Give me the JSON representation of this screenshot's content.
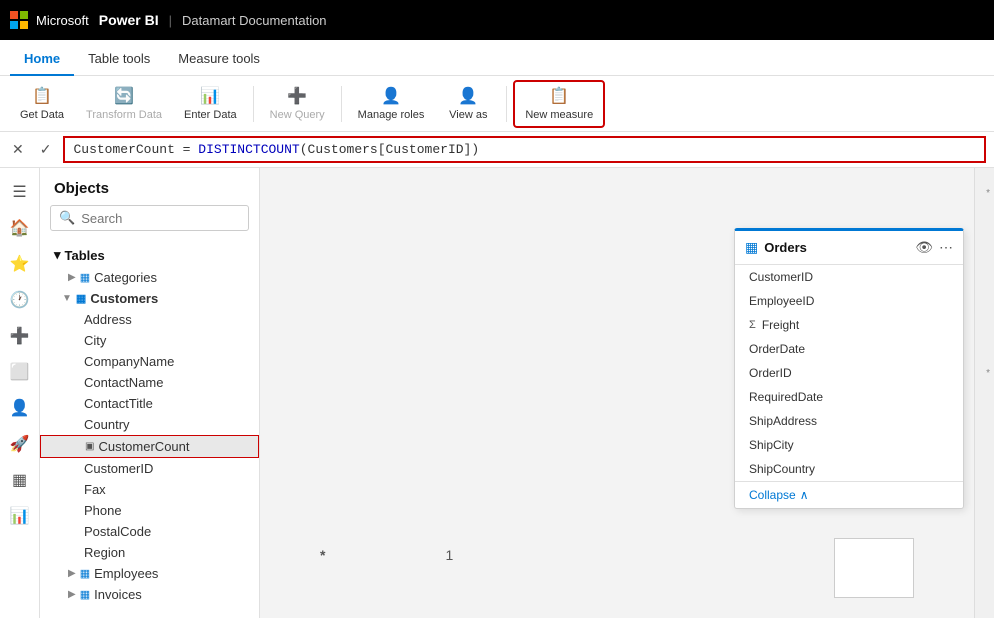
{
  "topbar": {
    "brand": "Microsoft",
    "appname": "Power BI",
    "divider": "|",
    "subtitle": "Datamart Documentation"
  },
  "ribbon": {
    "tabs": [
      {
        "label": "Home",
        "active": true
      },
      {
        "label": "Table tools",
        "active": false
      },
      {
        "label": "Measure tools",
        "active": false
      }
    ],
    "buttons": [
      {
        "label": "Get Data",
        "icon": "📋",
        "disabled": false
      },
      {
        "label": "Transform Data",
        "icon": "🔄",
        "disabled": true
      },
      {
        "label": "Enter Data",
        "icon": "📊",
        "disabled": false
      },
      {
        "label": "New Query",
        "icon": "➕",
        "disabled": true
      },
      {
        "label": "Manage roles",
        "icon": "👤",
        "disabled": false
      },
      {
        "label": "View as",
        "icon": "👤",
        "disabled": false
      },
      {
        "label": "New measure",
        "icon": "📋",
        "disabled": false,
        "highlighted": true
      }
    ]
  },
  "formula": {
    "cancel": "✕",
    "confirm": "✓",
    "expression": "CustomerCount = DISTINCTCOUNT(Customers[CustomerID])"
  },
  "sidebar_icons": [
    "☰",
    "🏠",
    "⭐",
    "🕐",
    "➕",
    "⬜",
    "👤",
    "🚀",
    "📋",
    "📊"
  ],
  "objects": {
    "title": "Objects",
    "search_placeholder": "Search",
    "tables_label": "Tables",
    "items": [
      {
        "label": "Categories",
        "type": "table",
        "indent": 1,
        "expanded": false
      },
      {
        "label": "Customers",
        "type": "table",
        "indent": 1,
        "expanded": true
      },
      {
        "label": "Address",
        "type": "field",
        "indent": 2
      },
      {
        "label": "City",
        "type": "field",
        "indent": 2
      },
      {
        "label": "CompanyName",
        "type": "field",
        "indent": 2
      },
      {
        "label": "ContactName",
        "type": "field",
        "indent": 2
      },
      {
        "label": "ContactTitle",
        "type": "field",
        "indent": 2
      },
      {
        "label": "Country",
        "type": "field",
        "indent": 2
      },
      {
        "label": "CustomerCount",
        "type": "measure",
        "indent": 2,
        "selected": true
      },
      {
        "label": "CustomerID",
        "type": "field",
        "indent": 2
      },
      {
        "label": "Fax",
        "type": "field",
        "indent": 2
      },
      {
        "label": "Phone",
        "type": "field",
        "indent": 2
      },
      {
        "label": "PostalCode",
        "type": "field",
        "indent": 2
      },
      {
        "label": "Region",
        "type": "field",
        "indent": 2
      },
      {
        "label": "Employees",
        "type": "table",
        "indent": 1,
        "expanded": false
      },
      {
        "label": "Invoices",
        "type": "table",
        "indent": 1,
        "expanded": false
      }
    ]
  },
  "orders_card": {
    "title": "Orders",
    "fields": [
      {
        "label": "CustomerID",
        "sigma": false
      },
      {
        "label": "EmployeeID",
        "sigma": false
      },
      {
        "label": "Freight",
        "sigma": true
      },
      {
        "label": "OrderDate",
        "sigma": false
      },
      {
        "label": "OrderID",
        "sigma": false
      },
      {
        "label": "RequiredDate",
        "sigma": false
      },
      {
        "label": "ShipAddress",
        "sigma": false
      },
      {
        "label": "ShipCity",
        "sigma": false
      },
      {
        "label": "ShipCountry",
        "sigma": false
      }
    ],
    "collapse_label": "Collapse"
  },
  "markers": {
    "bottom_left": "*",
    "bottom_mid": "1",
    "side_top": "*",
    "side_bottom": "*"
  }
}
